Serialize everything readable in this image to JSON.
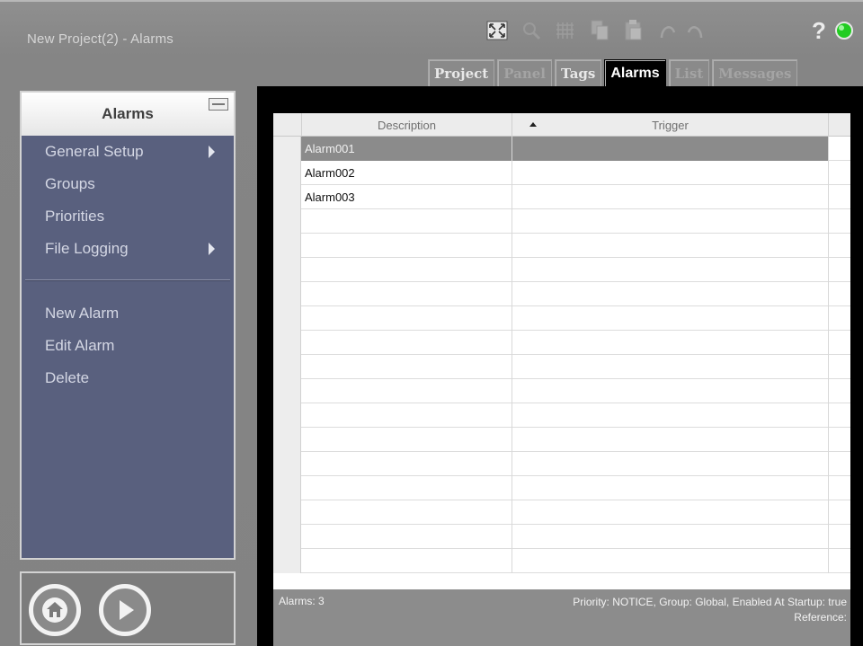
{
  "window": {
    "title": "New Project(2) - Alarms"
  },
  "toolbar": {
    "icons": [
      "fullscreen-icon",
      "magnifier-icon",
      "grid-icon",
      "copy-icon",
      "paste-icon",
      "undo-icon",
      "redo-icon",
      "help-icon",
      "status-led-icon"
    ],
    "help_label": "?"
  },
  "tabs": [
    {
      "label": "Project",
      "state": "enabled"
    },
    {
      "label": "Panel",
      "state": "disabled"
    },
    {
      "label": "Tags",
      "state": "enabled"
    },
    {
      "label": "Alarms",
      "state": "active"
    },
    {
      "label": "List",
      "state": "disabled"
    },
    {
      "label": "Messages",
      "state": "disabled"
    }
  ],
  "sidebar": {
    "title": "Alarms",
    "items": [
      {
        "label": "General Setup",
        "submenu": true
      },
      {
        "label": "Groups",
        "submenu": false
      },
      {
        "label": "Priorities",
        "submenu": false
      },
      {
        "label": "File Logging",
        "submenu": true
      }
    ],
    "actions": [
      {
        "label": "New Alarm"
      },
      {
        "label": "Edit Alarm"
      },
      {
        "label": "Delete"
      }
    ]
  },
  "table": {
    "columns": [
      "Description",
      "Trigger"
    ],
    "sort": {
      "column": "Description",
      "direction": "ascending"
    },
    "rows": [
      {
        "description": "Alarm001",
        "trigger": "",
        "selected": true
      },
      {
        "description": "Alarm002",
        "trigger": "",
        "selected": false
      },
      {
        "description": "Alarm003",
        "trigger": "",
        "selected": false
      }
    ],
    "empty_rows": 15
  },
  "status": {
    "count": "Alarms: 3",
    "details": "Priority: NOTICE, Group: Global, Enabled At Startup: true",
    "reference": "Reference:"
  },
  "colors": {
    "sidebar_bg": "#59607e",
    "led": "#22cc22",
    "selected_row": "#8b8b8b"
  }
}
